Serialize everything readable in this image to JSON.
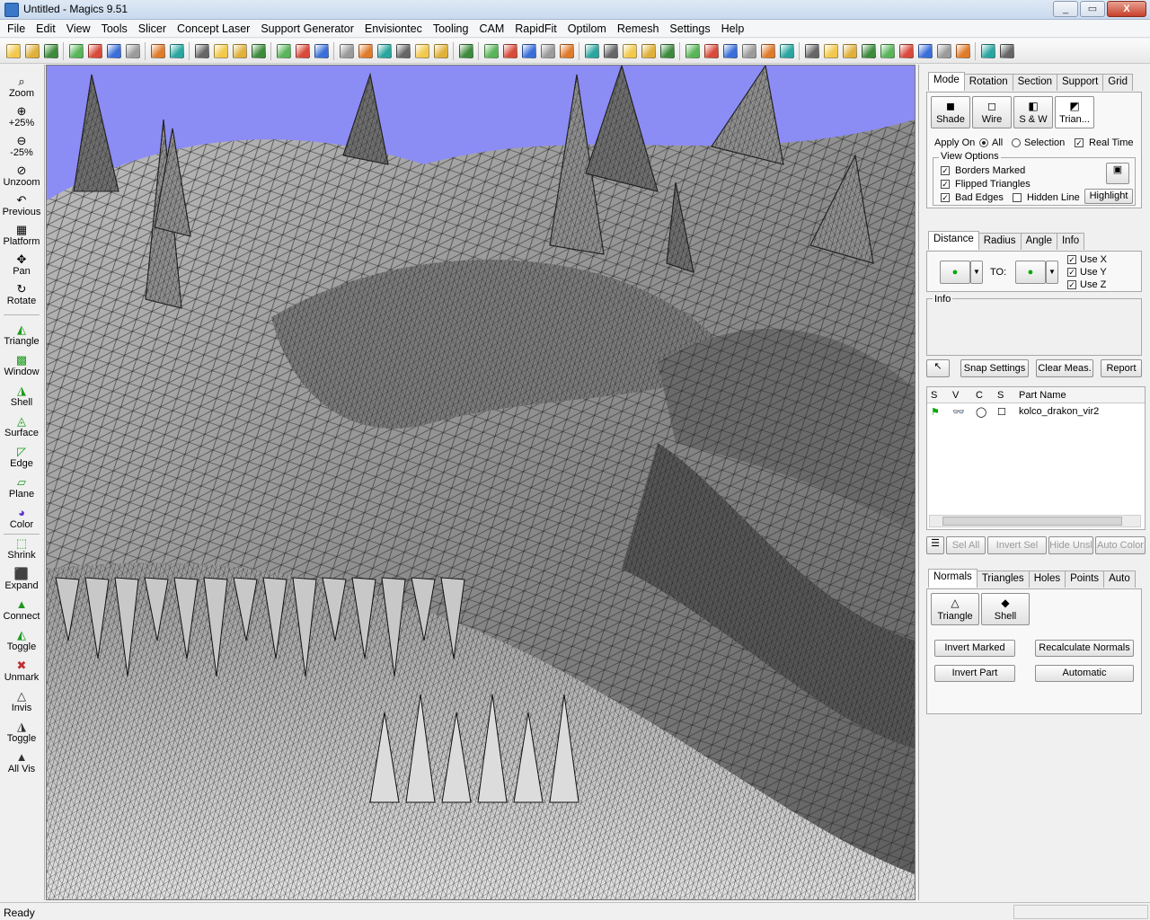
{
  "window": {
    "title": "Untitled - Magics 9.51",
    "minimize": "_",
    "maximize": "▭",
    "close": "X"
  },
  "menubar": [
    "File",
    "Edit",
    "View",
    "Tools",
    "Slicer",
    "Concept Laser",
    "Support Generator",
    "Envisiontec",
    "Tooling",
    "CAM",
    "RapidFit",
    "Optilom",
    "Remesh",
    "Settings",
    "Help"
  ],
  "toolbar_icons": [
    "new-file",
    "open-file",
    "save-file",
    "blank-doc",
    "open-folder",
    "save-disk",
    "print",
    "undo",
    "redo",
    "select-window",
    "select-window-2",
    "wand",
    "add-part",
    "pointer",
    "zoom-box",
    "hand",
    "green-cube-1",
    "green-cube-2",
    "green-cube-3",
    "red-tool",
    "green-cube-4",
    "cut-tool",
    "info",
    "measure-clock",
    "dollar",
    "red-cross",
    "yellow-cube",
    "paper-tag",
    "scissors",
    "blue-grid",
    "disk-mesh",
    "scissor-2",
    "layers-1",
    "layers-2",
    "hatch",
    "green-part-1",
    "green-part-2",
    "magnet",
    "green-part-3",
    "pyramid",
    "pencil-disk",
    "stack",
    "fork",
    "support-1",
    "support-2",
    "support-3",
    "support-4",
    "support-5",
    "cube-frame",
    "help"
  ],
  "left_tools_view": [
    "Zoom",
    "+25%",
    "-25%",
    "Unzoom",
    "Previous",
    "Platform",
    "Pan",
    "Rotate"
  ],
  "left_tools_mark": [
    "Triangle",
    "Window",
    "Shell",
    "Surface",
    "Edge",
    "Plane",
    "Color",
    "Shrink",
    "Expand",
    "Connect",
    "Toggle",
    "Unmark",
    "Invis",
    "Toggle",
    "All Vis"
  ],
  "colors": {
    "viewport_bg": "#8c8cf5",
    "mesh_dark": "#3a3a3a",
    "mesh_light": "#d8d8d8"
  },
  "mode_panel": {
    "tabs": [
      "Mode",
      "Rotation",
      "Section",
      "Support",
      "Grid"
    ],
    "active_tab": "Mode",
    "buttons": [
      "Shade",
      "Wire",
      "S & W",
      "Trian..."
    ],
    "apply_on_label": "Apply On",
    "apply_all": "All",
    "apply_selection": "Selection",
    "real_time": "Real Time",
    "view_options_title": "View Options",
    "borders_marked": "Borders Marked",
    "flipped_triangles": "Flipped Triangles",
    "bad_edges": "Bad Edges",
    "hidden_line": "Hidden Line",
    "highlight": "Highlight"
  },
  "measure_panel": {
    "tabs": [
      "Distance",
      "Radius",
      "Angle",
      "Info"
    ],
    "active_tab": "Distance",
    "to_label": "TO:",
    "use_x": "Use X",
    "use_y": "Use Y",
    "use_z": "Use Z",
    "info_title": "Info",
    "snap_settings": "Snap Settings",
    "clear_meas": "Clear Meas.",
    "report": "Report"
  },
  "parts_panel": {
    "headers": [
      "S",
      "V",
      "C",
      "S",
      "Part Name"
    ],
    "parts": [
      {
        "name": "kolco_drakon_vir2"
      }
    ],
    "buttons": [
      "Sel All",
      "Invert Sel",
      "Hide Unsl",
      "Auto Color"
    ]
  },
  "fix_panel": {
    "tabs": [
      "Normals",
      "Triangles",
      "Holes",
      "Points",
      "Auto"
    ],
    "active_tab": "Normals",
    "mode_buttons": [
      "Triangle",
      "Shell"
    ],
    "invert_marked": "Invert Marked",
    "recalculate_normals": "Recalculate Normals",
    "invert_part": "Invert Part",
    "automatic": "Automatic"
  },
  "status": {
    "text": "Ready"
  }
}
